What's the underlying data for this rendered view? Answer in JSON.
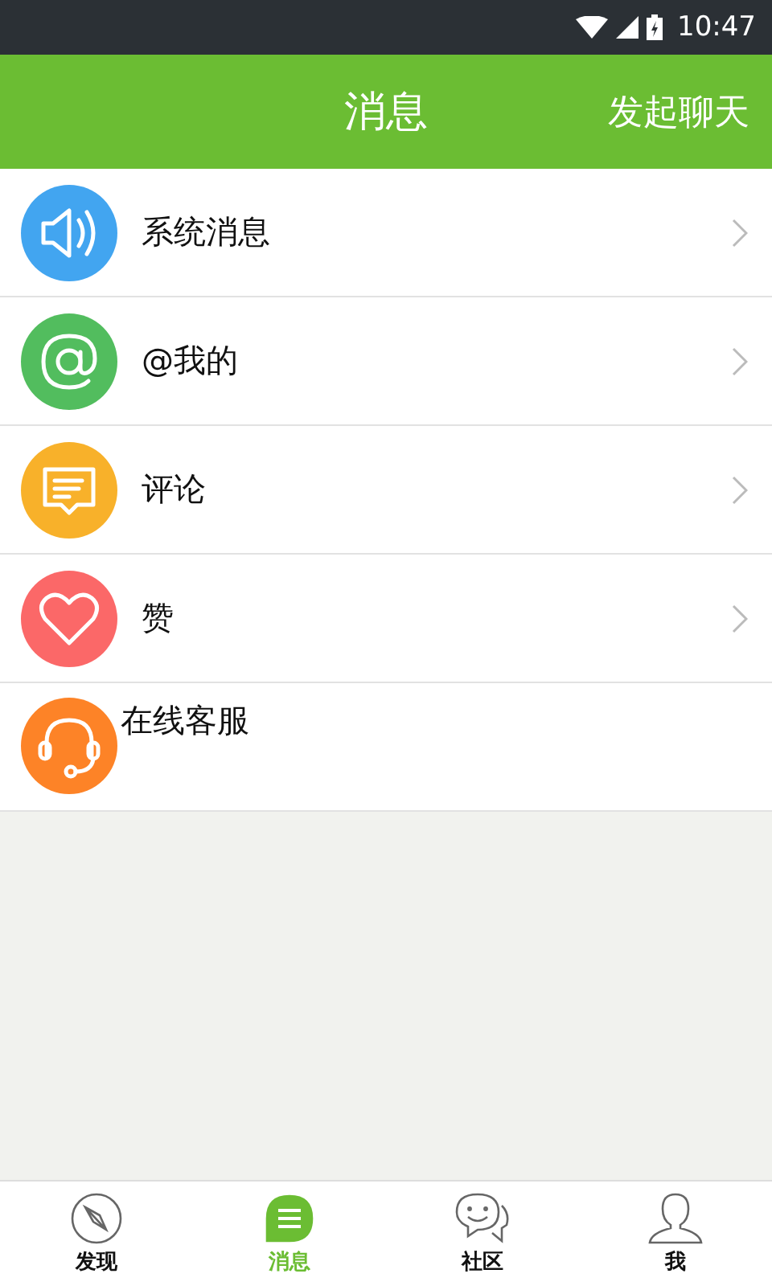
{
  "status_bar": {
    "time": "10:47"
  },
  "header": {
    "title": "消息",
    "action": "发起聊天"
  },
  "items": [
    {
      "kind": "speaker",
      "label": "系统消息",
      "color": "#42a5f0",
      "chevron": true
    },
    {
      "kind": "at",
      "label": "@我的",
      "color": "#52bd5e",
      "chevron": true
    },
    {
      "kind": "comment",
      "label": "评论",
      "color": "#f8b12a",
      "chevron": true
    },
    {
      "kind": "heart",
      "label": "赞",
      "color": "#fb6868",
      "chevron": true
    },
    {
      "kind": "headset",
      "label": "在线客服",
      "color": "#fd8327",
      "chevron": false
    }
  ],
  "tabs": [
    {
      "kind": "compass",
      "label": "发现",
      "selected": false
    },
    {
      "kind": "messages",
      "label": "消息",
      "selected": true
    },
    {
      "kind": "community",
      "label": "社区",
      "selected": false
    },
    {
      "kind": "person",
      "label": "我",
      "selected": false
    }
  ]
}
